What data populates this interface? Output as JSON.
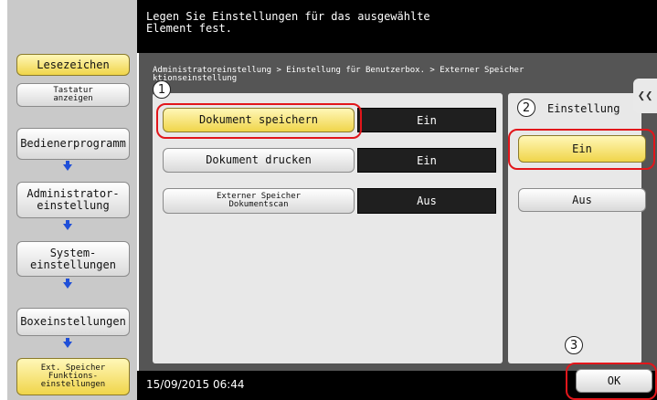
{
  "header": {
    "message": "Legen Sie Einstellungen für das ausgewählte\nElement fest."
  },
  "sidebar": {
    "bookmark_label": "Lesezeichen",
    "keyboard_label": "Tastatur\nanzeigen",
    "items": [
      {
        "label": "Bedienerprogramm"
      },
      {
        "label": "Administrator-\neinstellung"
      },
      {
        "label": "System-\neinstellungen"
      },
      {
        "label": "Boxeinstellungen"
      },
      {
        "label": "Ext. Speicher\nFunktions-\neinstellungen"
      }
    ]
  },
  "breadcrumb": "Administratoreinstellung > Einstellung für Benutzerbox. > Externer Speicher\nktionseinstellung",
  "functions": [
    {
      "label": "Dokument speichern",
      "status": "Ein"
    },
    {
      "label": "Dokument drucken",
      "status": "Ein"
    },
    {
      "label": "Externer Speicher\nDokumentscan",
      "status": "Aus"
    }
  ],
  "setting_panel": {
    "title": "Einstellung",
    "on_label": "Ein",
    "off_label": "Aus"
  },
  "footer": {
    "datetime": "15/09/2015   06:44",
    "ok_label": "OK"
  },
  "callouts": [
    "1",
    "2",
    "3"
  ],
  "colors": {
    "highlight": "#e2161b",
    "selected": "#f0d54a",
    "arrow": "#1f4fd8"
  }
}
